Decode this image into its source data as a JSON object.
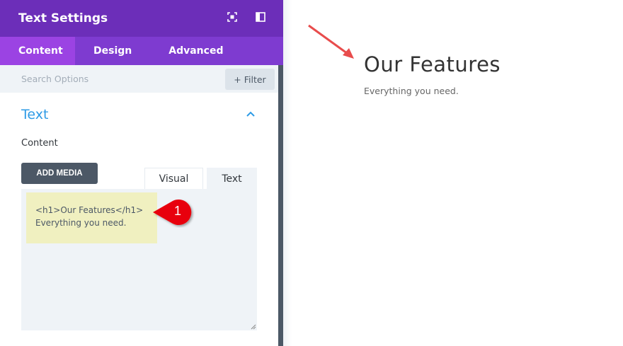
{
  "panel": {
    "title": "Text Settings",
    "tabs": [
      "Content",
      "Design",
      "Advanced"
    ],
    "search_placeholder": "Search Options",
    "filter_label": "+ Filter",
    "section_title": "Text",
    "content_label": "Content",
    "add_media": "ADD MEDIA",
    "editor_tabs": [
      "Visual",
      "Text"
    ],
    "editor_lines": [
      "<h1>Our Features</h1>",
      "Everything you need."
    ],
    "callout_number": "1"
  },
  "preview": {
    "heading": "Our Features",
    "subtext": "Everything you need."
  },
  "colors": {
    "header": "#6c2eb9",
    "tabs": "#7e3bd0",
    "active_tab": "#9b43e3",
    "accent": "#2e9be6",
    "callout": "#e8000a",
    "arrow": "#e84c4c"
  }
}
